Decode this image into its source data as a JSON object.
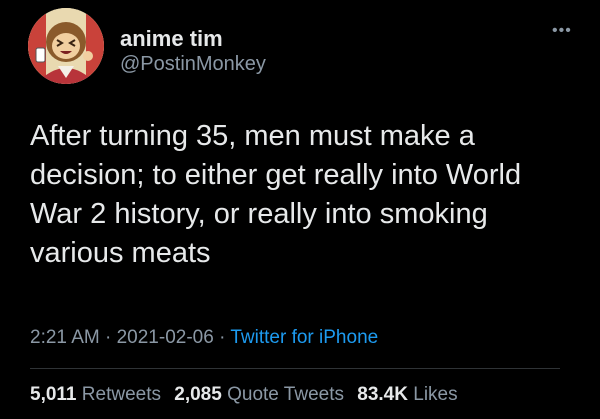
{
  "author": {
    "display_name": "anime tim",
    "handle": "@PostinMonkey"
  },
  "tweet": {
    "text": "After turning 35, men must make a decision; to either get really into World War 2 history, or really into smoking various meats"
  },
  "meta": {
    "time": "2:21 AM",
    "separator": " · ",
    "date": "2021-02-06",
    "source": "Twitter for iPhone"
  },
  "stats": {
    "retweets_count": "5,011",
    "retweets_label": "Retweets",
    "quote_count": "2,085",
    "quote_label": "Quote Tweets",
    "likes_count": "83.4K",
    "likes_label": "Likes"
  },
  "icons": {
    "more": "more-dots-icon",
    "avatar": "monkey-avatar"
  },
  "colors": {
    "background": "#000000",
    "text": "#e7e9ea",
    "muted": "#8b98a5",
    "link": "#1d9bf0"
  }
}
